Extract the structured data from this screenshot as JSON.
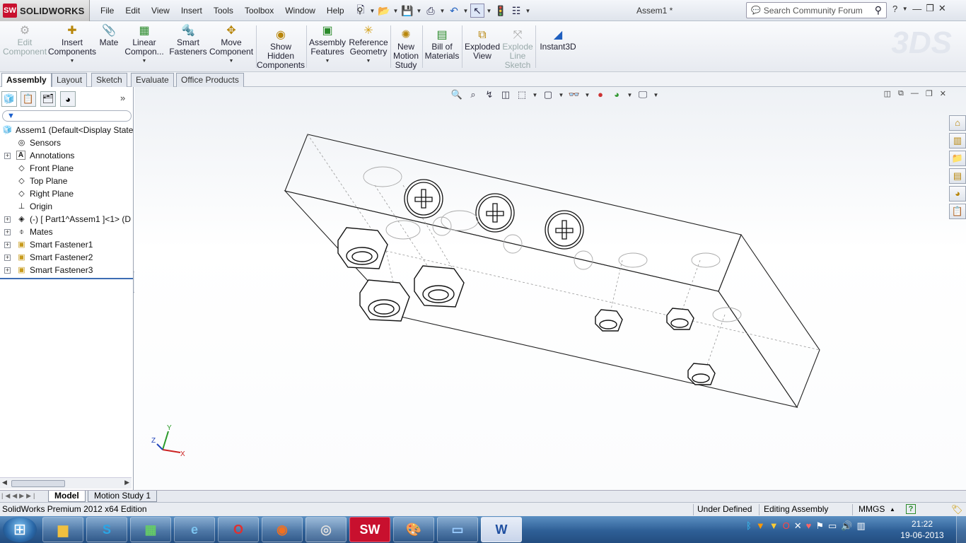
{
  "app": {
    "logo_text": "SOLIDWORKS",
    "logo_badge": "SW",
    "document_title": "Assem1 *",
    "search_placeholder": "Search Community Forum"
  },
  "menu": [
    "File",
    "Edit",
    "View",
    "Insert",
    "Tools",
    "Toolbox",
    "Window",
    "Help"
  ],
  "command_manager": [
    {
      "label": "Edit\nComponent",
      "icon": "edit-component-icon",
      "disabled": true
    },
    {
      "label": "Insert\nComponents",
      "icon": "insert-components-icon",
      "disabled": false,
      "dropdown": true
    },
    {
      "label": "Mate",
      "icon": "mate-icon",
      "disabled": false
    },
    {
      "label": "Linear\nCompon...",
      "icon": "linear-pattern-icon",
      "disabled": false,
      "dropdown": true
    },
    {
      "label": "Smart\nFasteners",
      "icon": "smart-fasteners-icon",
      "disabled": false
    },
    {
      "label": "Move\nComponent",
      "icon": "move-component-icon",
      "disabled": false,
      "dropdown": true
    },
    {
      "label": "Show\nHidden\nComponents",
      "icon": "show-hidden-icon",
      "disabled": false
    },
    {
      "label": "Assembly\nFeatures",
      "icon": "assembly-features-icon",
      "disabled": false,
      "dropdown": true
    },
    {
      "label": "Reference\nGeometry",
      "icon": "reference-geometry-icon",
      "disabled": false,
      "dropdown": true
    },
    {
      "label": "New\nMotion\nStudy",
      "icon": "motion-study-icon",
      "disabled": false
    },
    {
      "label": "Bill of\nMaterials",
      "icon": "bom-icon",
      "disabled": false
    },
    {
      "label": "Exploded\nView",
      "icon": "exploded-view-icon",
      "disabled": false
    },
    {
      "label": "Explode\nLine\nSketch",
      "icon": "explode-line-icon",
      "disabled": true
    },
    {
      "label": "Instant3D",
      "icon": "instant3d-icon",
      "disabled": false
    }
  ],
  "cm_tabs": [
    "Assembly",
    "Layout",
    "Sketch",
    "Evaluate",
    "Office Products"
  ],
  "active_cm_tab": "Assembly",
  "tree": [
    {
      "label": "Assem1  (Default<Display State",
      "icon": "assembly-icon",
      "expander": ""
    },
    {
      "label": "Sensors",
      "icon": "sensor-icon",
      "expander": ""
    },
    {
      "label": "Annotations",
      "icon": "annotations-icon",
      "expander": "+"
    },
    {
      "label": "Front Plane",
      "icon": "plane-icon",
      "expander": ""
    },
    {
      "label": "Top Plane",
      "icon": "plane-icon",
      "expander": ""
    },
    {
      "label": "Right Plane",
      "icon": "plane-icon",
      "expander": ""
    },
    {
      "label": "Origin",
      "icon": "origin-icon",
      "expander": ""
    },
    {
      "label": "(-) [ Part1^Assem1 ]<1> (D",
      "icon": "part-icon",
      "expander": "+"
    },
    {
      "label": "Mates",
      "icon": "mates-icon",
      "expander": "+"
    },
    {
      "label": "Smart Fastener1",
      "icon": "folder-icon",
      "expander": "+"
    },
    {
      "label": "Smart Fastener2",
      "icon": "folder-icon",
      "expander": "+"
    },
    {
      "label": "Smart Fastener3",
      "icon": "folder-icon",
      "expander": "+"
    }
  ],
  "bottom_tabs": [
    "Model",
    "Motion Study 1"
  ],
  "active_bottom_tab": "Model",
  "status": {
    "edition": "SolidWorks Premium 2012 x64 Edition",
    "definition": "Under Defined",
    "mode": "Editing Assembly",
    "units": "MMGS",
    "units_arrow": "▲",
    "help": "?"
  },
  "triad": {
    "x": "X",
    "y": "Y",
    "z": "Z"
  },
  "taskbar": {
    "time": "21:22",
    "date": "19-06-2013",
    "apps": [
      "file-explorer",
      "skype",
      "task-manager",
      "internet-explorer",
      "opera",
      "firefox",
      "chrome",
      "solidworks",
      "paint",
      "photo-viewer",
      "word"
    ]
  },
  "colors": {
    "accent": "#3d6db4",
    "taskbar": "#2e5f96",
    "sw_red": "#c8102e"
  }
}
